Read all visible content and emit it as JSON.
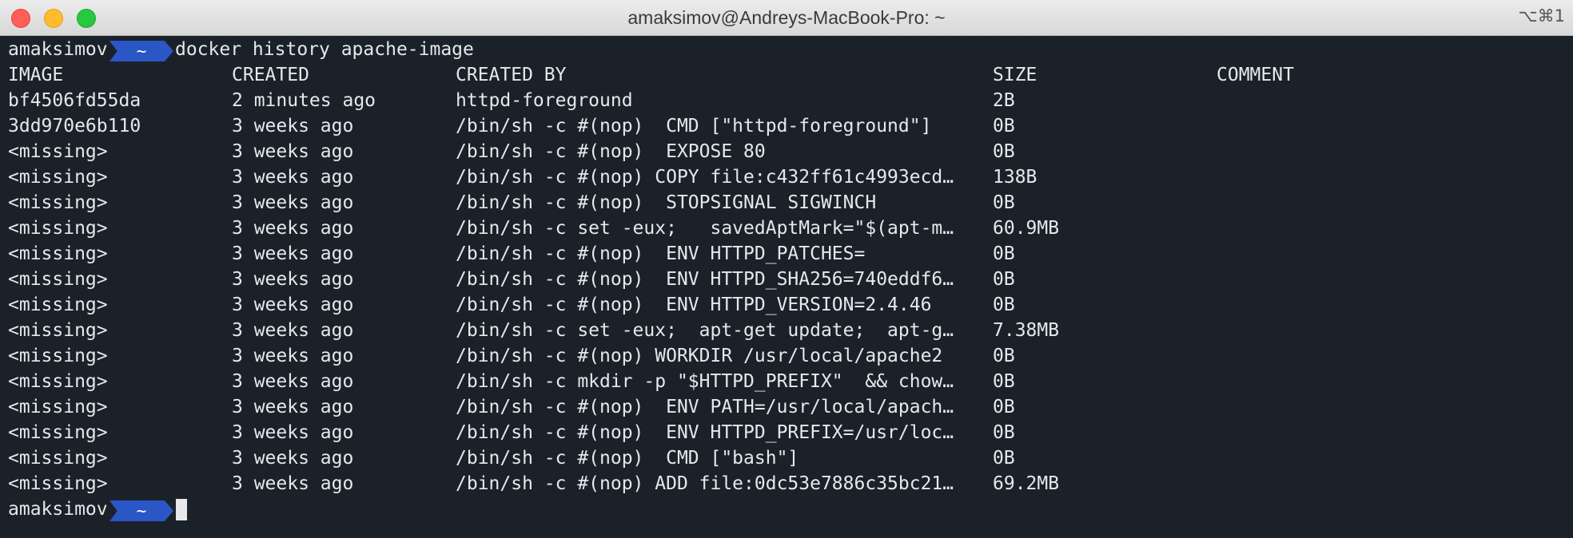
{
  "window": {
    "title": "amaksimov@Andreys-MacBook-Pro: ~",
    "shortcut": "⌥⌘1"
  },
  "prompt": {
    "user": "amaksimov",
    "dir": "~",
    "command": "docker history apache-image"
  },
  "table": {
    "headers": {
      "image": "IMAGE",
      "created": "CREATED",
      "created_by": "CREATED BY",
      "size": "SIZE",
      "comment": "COMMENT"
    },
    "rows": [
      {
        "image": "bf4506fd55da",
        "created": "2 minutes ago",
        "created_by": "httpd-foreground",
        "size": "2B"
      },
      {
        "image": "3dd970e6b110",
        "created": "3 weeks ago",
        "created_by": "/bin/sh -c #(nop)  CMD [\"httpd-foreground\"]",
        "size": "0B"
      },
      {
        "image": "<missing>",
        "created": "3 weeks ago",
        "created_by": "/bin/sh -c #(nop)  EXPOSE 80",
        "size": "0B"
      },
      {
        "image": "<missing>",
        "created": "3 weeks ago",
        "created_by": "/bin/sh -c #(nop) COPY file:c432ff61c4993ecd…",
        "size": "138B"
      },
      {
        "image": "<missing>",
        "created": "3 weeks ago",
        "created_by": "/bin/sh -c #(nop)  STOPSIGNAL SIGWINCH",
        "size": "0B"
      },
      {
        "image": "<missing>",
        "created": "3 weeks ago",
        "created_by": "/bin/sh -c set -eux;   savedAptMark=\"$(apt-m…",
        "size": "60.9MB"
      },
      {
        "image": "<missing>",
        "created": "3 weeks ago",
        "created_by": "/bin/sh -c #(nop)  ENV HTTPD_PATCHES=",
        "size": "0B"
      },
      {
        "image": "<missing>",
        "created": "3 weeks ago",
        "created_by": "/bin/sh -c #(nop)  ENV HTTPD_SHA256=740eddf6…",
        "size": "0B"
      },
      {
        "image": "<missing>",
        "created": "3 weeks ago",
        "created_by": "/bin/sh -c #(nop)  ENV HTTPD_VERSION=2.4.46",
        "size": "0B"
      },
      {
        "image": "<missing>",
        "created": "3 weeks ago",
        "created_by": "/bin/sh -c set -eux;  apt-get update;  apt-g…",
        "size": "7.38MB"
      },
      {
        "image": "<missing>",
        "created": "3 weeks ago",
        "created_by": "/bin/sh -c #(nop) WORKDIR /usr/local/apache2",
        "size": "0B"
      },
      {
        "image": "<missing>",
        "created": "3 weeks ago",
        "created_by": "/bin/sh -c mkdir -p \"$HTTPD_PREFIX\"  && chow…",
        "size": "0B"
      },
      {
        "image": "<missing>",
        "created": "3 weeks ago",
        "created_by": "/bin/sh -c #(nop)  ENV PATH=/usr/local/apach…",
        "size": "0B"
      },
      {
        "image": "<missing>",
        "created": "3 weeks ago",
        "created_by": "/bin/sh -c #(nop)  ENV HTTPD_PREFIX=/usr/loc…",
        "size": "0B"
      },
      {
        "image": "<missing>",
        "created": "3 weeks ago",
        "created_by": "/bin/sh -c #(nop)  CMD [\"bash\"]",
        "size": "0B"
      },
      {
        "image": "<missing>",
        "created": "3 weeks ago",
        "created_by": "/bin/sh -c #(nop) ADD file:0dc53e7886c35bc21…",
        "size": "69.2MB"
      }
    ]
  },
  "colors": {
    "background": "#1b2129",
    "foreground": "#e6e8ea",
    "prompt_badge": "#2a56c6"
  }
}
